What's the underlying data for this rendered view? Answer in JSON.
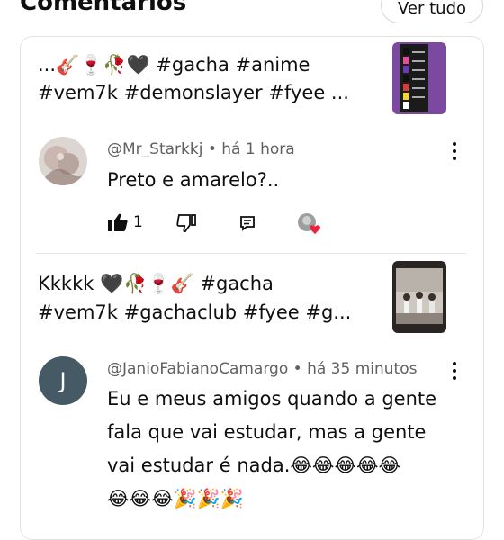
{
  "header": {
    "title": "Comentários",
    "view_all_label": "Ver tudo"
  },
  "threads": [
    {
      "video_title_line1": "...🎸🍷🥀🖤 #gacha #anime",
      "video_title_line2": "#vem7k #demonslayer #fyee ...",
      "comment": {
        "author": "@Mr_Starkkj",
        "time": "há 1 hora",
        "lines": [
          "Preto e amarelo?.."
        ],
        "likes": "1"
      }
    },
    {
      "video_title_line1": "Kkkkk 🖤🥀🍷🎸 #gacha",
      "video_title_line2": "#vem7k #gachaclub #fyee #g...",
      "comment": {
        "author": "@JanioFabianoCamargo",
        "time": "há 35 minutos",
        "avatar_letter": "J",
        "lines": [
          "Eu e meus amigos quando a gente",
          "fala que vai estudar, mas a gente",
          "vai estudar é nada.😂😂😂😂😂",
          "😂😂😂🎉🎉🎉"
        ]
      }
    }
  ],
  "colors": {
    "like_heart": "#e8233a",
    "avatar_j": "#455a64",
    "divider": "#e5e5e5"
  }
}
